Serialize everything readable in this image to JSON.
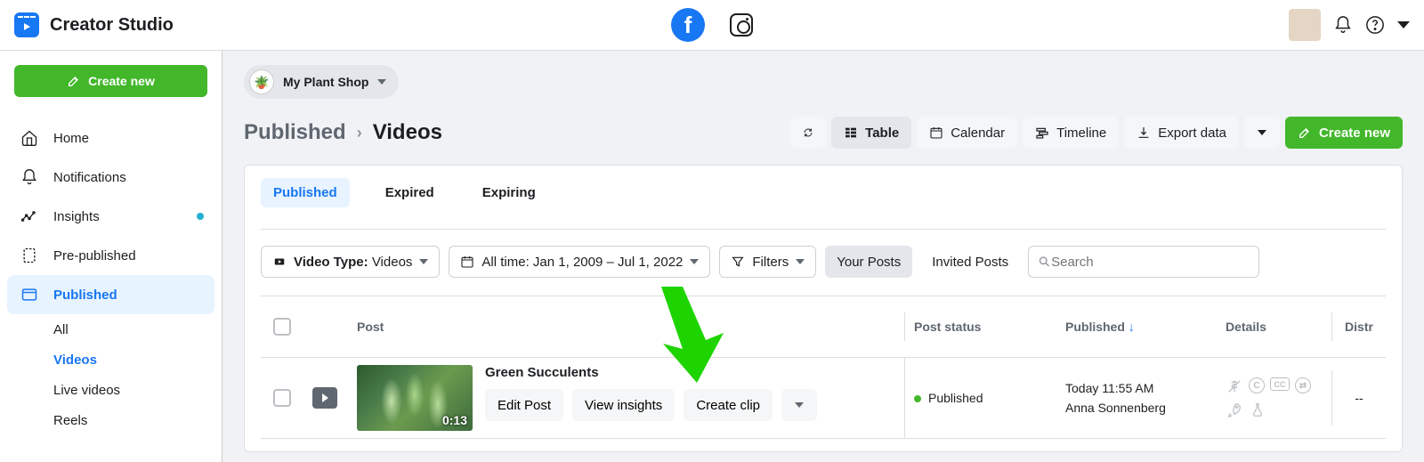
{
  "header": {
    "app_title": "Creator Studio"
  },
  "sidebar": {
    "create_label": "Create new",
    "items": [
      {
        "label": "Home"
      },
      {
        "label": "Notifications"
      },
      {
        "label": "Insights"
      },
      {
        "label": "Pre-published"
      },
      {
        "label": "Published"
      }
    ],
    "published_subitems": [
      {
        "label": "All"
      },
      {
        "label": "Videos"
      },
      {
        "label": "Live videos"
      },
      {
        "label": "Reels"
      }
    ]
  },
  "page_selector": {
    "name": "My Plant Shop"
  },
  "breadcrumb": {
    "parent": "Published",
    "current": "Videos"
  },
  "view_toolbar": {
    "table": "Table",
    "calendar": "Calendar",
    "timeline": "Timeline",
    "export": "Export data",
    "create": "Create new"
  },
  "tabs": {
    "published": "Published",
    "expired": "Expired",
    "expiring": "Expiring"
  },
  "filters": {
    "video_type_label": "Video Type:",
    "video_type_value": "Videos",
    "date_range": "All time: Jan 1, 2009 – Jul 1, 2022",
    "filters_label": "Filters",
    "your_posts": "Your Posts",
    "invited_posts": "Invited Posts",
    "search_placeholder": "Search"
  },
  "table": {
    "columns": {
      "post": "Post",
      "status": "Post status",
      "published": "Published",
      "details": "Details",
      "distr": "Distr"
    },
    "rows": [
      {
        "title": "Green Succulents",
        "duration": "0:13",
        "status": "Published",
        "published_time": "Today 11:55 AM",
        "author": "Anna Sonnenberg",
        "distr": "--",
        "actions": {
          "edit": "Edit Post",
          "insights": "View insights",
          "clip": "Create clip"
        }
      }
    ]
  }
}
